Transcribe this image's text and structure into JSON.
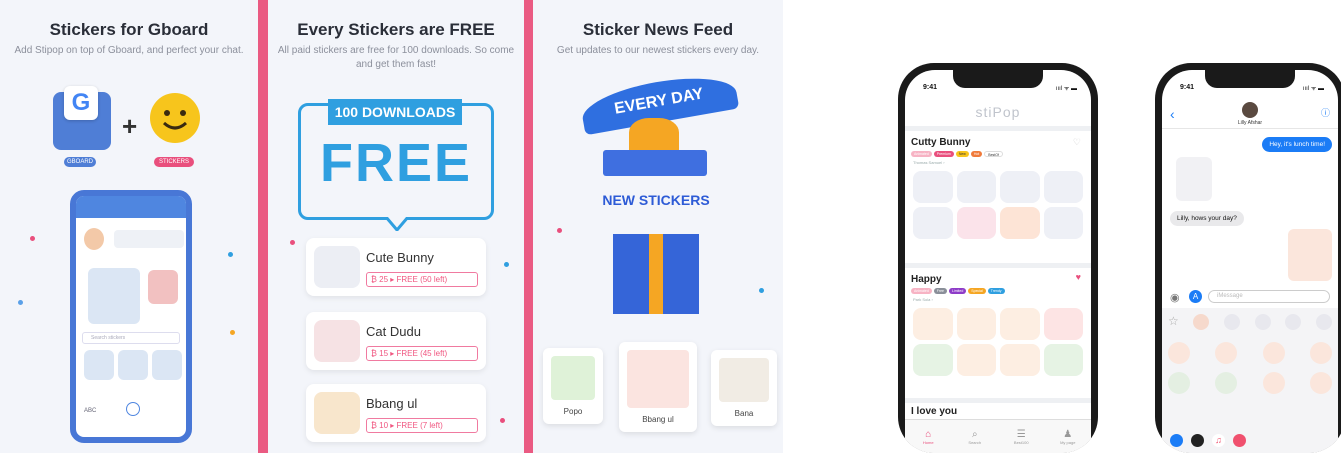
{
  "panel1": {
    "title": "Stickers for Gboard",
    "subtitle": "Add Stipop on top of Gboard, and perfect your chat.",
    "gboard_letter": "G",
    "plus": "+",
    "tag_left": "GBOARD",
    "tag_right": "STICKERS",
    "phone_search_placeholder": "Search stickers",
    "phone_kb_label": "ABC"
  },
  "panel2": {
    "title": "Every Stickers are FREE",
    "subtitle": "All paid stickers are free for 100 downloads. So come and get them fast!",
    "banner": "100 DOWNLOADS",
    "free": "FREE",
    "cards": [
      {
        "name": "Cute Bunny",
        "price": "₿ 25 ▸ FREE (50 left)"
      },
      {
        "name": "Cat Dudu",
        "price": "₿ 15 ▸ FREE (45 left)"
      },
      {
        "name": "Bbang ul",
        "price": "₿ 10 ▸ FREE (7 left)"
      }
    ]
  },
  "panel3": {
    "title": "Sticker News Feed",
    "subtitle": "Get updates to our newest stickers every day.",
    "banner": "EVERY DAY",
    "new_stickers": "NEW STICKERS",
    "cards": [
      {
        "name": "Popo"
      },
      {
        "name": "Bbang ul"
      },
      {
        "name": "Bana"
      }
    ]
  },
  "phone_left": {
    "time": "9:41",
    "signal": "ıııl ᯤ ▬",
    "app_title": "stiPop",
    "section1": {
      "title": "Cutty Bunny",
      "chips": [
        "Animated",
        "Premium",
        "New",
        "Hot",
        "BestOf"
      ],
      "author": "Thomas Samuel ›"
    },
    "section2": {
      "title": "Happy",
      "chips": [
        "Animated",
        "Free",
        "Limited",
        "Special",
        "Trendy"
      ],
      "author": "Park Sola ›"
    },
    "section3_title": "I love you",
    "tabs": [
      {
        "icon": "⌂",
        "label": "Home"
      },
      {
        "icon": "⌕",
        "label": "Search"
      },
      {
        "icon": "☰",
        "label": "Best100"
      },
      {
        "icon": "♟",
        "label": "My page"
      }
    ]
  },
  "phone_right": {
    "time": "9:41",
    "signal": "ıııl ᯤ ▬",
    "contact": "Lilly Afshar",
    "back": "‹",
    "info": "ⓘ",
    "msg_out": "Hey, it's lunch time!",
    "msg_in": "Lilly, hows your day?",
    "input_placeholder": "iMessage"
  },
  "colors": {
    "pink": "#ea5a82",
    "blue": "#2f9fe0",
    "brand_blue": "#3565d8",
    "imessage_blue": "#1b7cf6"
  }
}
